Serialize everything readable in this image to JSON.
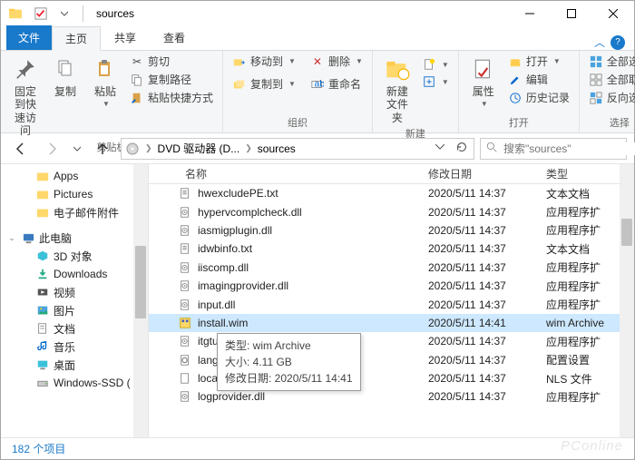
{
  "window": {
    "title": "sources"
  },
  "tabs": {
    "file": "文件",
    "home": "主页",
    "share": "共享",
    "view": "查看"
  },
  "ribbon": {
    "group_clipboard": {
      "label": "剪贴板",
      "pin": "固定到快\n速访问",
      "copy": "复制",
      "paste": "粘贴",
      "cut": "剪切",
      "copypath": "复制路径",
      "pasteshortcut": "粘贴快捷方式"
    },
    "group_organize": {
      "label": "组织",
      "moveto": "移动到",
      "copyto": "复制到",
      "delete": "删除",
      "rename": "重命名"
    },
    "group_new": {
      "label": "新建",
      "newfolder": "新建\n文件夹"
    },
    "group_open": {
      "label": "打开",
      "properties": "属性",
      "open": "打开",
      "edit": "编辑",
      "history": "历史记录"
    },
    "group_select": {
      "label": "选择",
      "selectall": "全部选择",
      "selectnone": "全部取消",
      "invert": "反向选择"
    }
  },
  "breadcrumb": {
    "drive": "DVD 驱动器 (D...",
    "folder": "sources"
  },
  "search": {
    "placeholder": "搜索\"sources\""
  },
  "navpane": {
    "apps": "Apps",
    "pictures": "Pictures",
    "mailattach": "电子邮件附件",
    "thispc": "此电脑",
    "objects3d": "3D 对象",
    "downloads": "Downloads",
    "videos": "视频",
    "images": "图片",
    "documents": "文档",
    "music": "音乐",
    "desktop": "桌面",
    "windowsssd": "Windows-SSD ("
  },
  "columns": {
    "name": "名称",
    "date": "修改日期",
    "type": "类型"
  },
  "files": [
    {
      "name": "hwexcludePE.txt",
      "date": "2020/5/11 14:37",
      "type": "文本文档",
      "icon": "txt"
    },
    {
      "name": "hypervcomplcheck.dll",
      "date": "2020/5/11 14:37",
      "type": "应用程序扩",
      "icon": "dll"
    },
    {
      "name": "iasmigplugin.dll",
      "date": "2020/5/11 14:37",
      "type": "应用程序扩",
      "icon": "dll"
    },
    {
      "name": "idwbinfo.txt",
      "date": "2020/5/11 14:37",
      "type": "文本文档",
      "icon": "txt"
    },
    {
      "name": "iiscomp.dll",
      "date": "2020/5/11 14:37",
      "type": "应用程序扩",
      "icon": "dll"
    },
    {
      "name": "imagingprovider.dll",
      "date": "2020/5/11 14:37",
      "type": "应用程序扩",
      "icon": "dll"
    },
    {
      "name": "input.dll",
      "date": "2020/5/11 14:37",
      "type": "应用程序扩",
      "icon": "dll"
    },
    {
      "name": "install.wim",
      "date": "2020/5/11 14:41",
      "type": "wim Archive",
      "icon": "wim",
      "selected": true
    },
    {
      "name": "itgtupg.dll",
      "date": "2020/5/11 14:37",
      "type": "应用程序扩",
      "icon": "dll"
    },
    {
      "name": "lang.ini",
      "date": "2020/5/11 14:37",
      "type": "配置设置",
      "icon": "ini"
    },
    {
      "name": "locale.nls",
      "date": "2020/5/11 14:37",
      "type": "NLS 文件",
      "icon": "nls"
    },
    {
      "name": "logprovider.dll",
      "date": "2020/5/11 14:37",
      "type": "应用程序扩",
      "icon": "dll"
    }
  ],
  "tooltip": {
    "line1": "类型: wim Archive",
    "line2": "大小: 4.11 GB",
    "line3": "修改日期: 2020/5/11 14:41"
  },
  "status": {
    "text": "182 个项目"
  }
}
